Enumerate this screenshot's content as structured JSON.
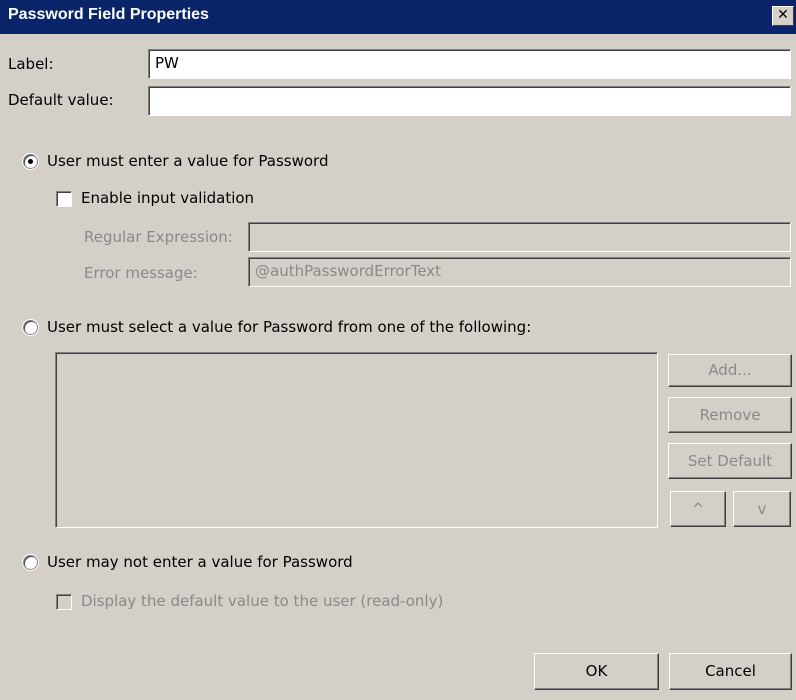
{
  "window": {
    "title": "Password Field Properties",
    "close_glyph": "✕"
  },
  "fields": {
    "label_caption": "Label:",
    "label_value": "PW",
    "default_caption": "Default value:",
    "default_value": ""
  },
  "option_enter": {
    "label": "User must enter a value for Password",
    "selected": true,
    "validation_label": "Enable input validation",
    "validation_checked": false,
    "regex_caption": "Regular Expression:",
    "regex_value": "",
    "error_caption": "Error message:",
    "error_value": "@authPasswordErrorText"
  },
  "option_select": {
    "label": "User must select a value for Password from one of the following:",
    "selected": false,
    "buttons": {
      "add": "Add...",
      "remove": "Remove",
      "set_default": "Set Default",
      "up": "^",
      "down": "v"
    }
  },
  "option_none": {
    "label": "User may not enter a value for Password",
    "selected": false,
    "readonly_label": "Display the default value to the user (read-only)",
    "readonly_checked": false
  },
  "footer": {
    "ok": "OK",
    "cancel": "Cancel"
  }
}
